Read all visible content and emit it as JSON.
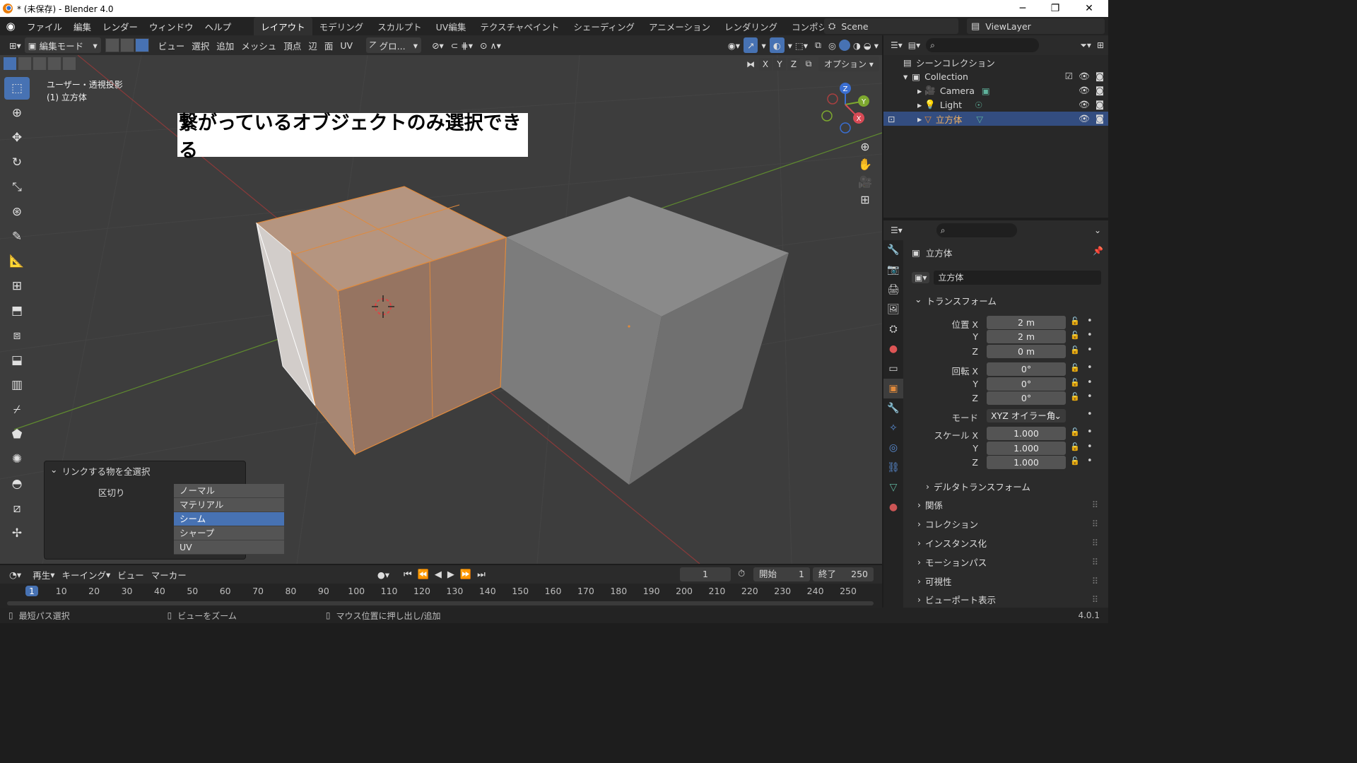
{
  "window": {
    "title": "* (未保存) - Blender 4.0",
    "minimize": "─",
    "maximize": "❐",
    "close": "✕"
  },
  "menu": [
    "ファイル",
    "編集",
    "レンダー",
    "ウィンドウ",
    "ヘルプ"
  ],
  "workspaces": [
    "レイアウト",
    "モデリング",
    "スカルプト",
    "UV編集",
    "テクスチャペイント",
    "シェーディング",
    "アニメーション",
    "レンダリング",
    "コンポジティング"
  ],
  "scene": {
    "name": "Scene",
    "view_layer": "ViewLayer"
  },
  "viewport_header": {
    "mode": "編集モード",
    "menus": [
      "ビュー",
      "選択",
      "追加",
      "メッシュ",
      "頂点",
      "辺",
      "面",
      "UV"
    ],
    "transform_orientation": "グロ...",
    "axis_x": "X",
    "axis_y": "Y",
    "axis_z": "Z",
    "options": "オプション"
  },
  "viewport": {
    "view_name": "ユーザー・透視投影",
    "object_label": "(1) 立方体",
    "annotation": "繋がっているオブジェクトのみ選択できる",
    "gizmo": {
      "x": "X",
      "y": "Y",
      "z": "Z"
    }
  },
  "operator_panel": {
    "title": "リンクする物を全選択",
    "delimit_label": "区切り",
    "options": [
      "ノーマル",
      "マテリアル",
      "シーム",
      "シャープ",
      "UV"
    ],
    "selected": "シーム"
  },
  "timeline": {
    "menus": [
      "再生",
      "キーイング",
      "ビュー",
      "マーカー"
    ],
    "current_frame": "1",
    "start_label": "開始",
    "start": "1",
    "end_label": "終了",
    "end": "250",
    "ticks": [
      "1",
      "10",
      "20",
      "30",
      "40",
      "50",
      "60",
      "70",
      "80",
      "90",
      "100",
      "110",
      "120",
      "130",
      "140",
      "150",
      "160",
      "170",
      "180",
      "190",
      "200",
      "210",
      "220",
      "230",
      "240",
      "250"
    ]
  },
  "statusbar": {
    "left": "最短パス選択",
    "middle": "ビューをズーム",
    "right": "マウス位置に押し出し/追加",
    "version": "4.0.1"
  },
  "outliner": {
    "root": "シーンコレクション",
    "collection": "Collection",
    "items": [
      "Camera",
      "Light",
      "立方体"
    ]
  },
  "properties": {
    "object_name": "立方体",
    "data_name": "立方体",
    "transform": "トランスフォーム",
    "location_label": "位置 X",
    "rotation_label": "回転 X",
    "scale_label": "スケール X",
    "axis_y": "Y",
    "axis_z": "Z",
    "location": [
      "2 m",
      "2 m",
      "0 m"
    ],
    "rotation": [
      "0°",
      "0°",
      "0°"
    ],
    "mode_label": "モード",
    "mode": "XYZ オイラー角",
    "scale": [
      "1.000",
      "1.000",
      "1.000"
    ],
    "sections": [
      "デルタトランスフォーム",
      "関係",
      "コレクション",
      "インスタンス化",
      "モーションパス",
      "可視性",
      "ビューポート表示"
    ]
  },
  "colors": {
    "accent": "#4772b3",
    "selected_orange": "#e08a3c",
    "viewport_bg": "#3d3d3d"
  }
}
